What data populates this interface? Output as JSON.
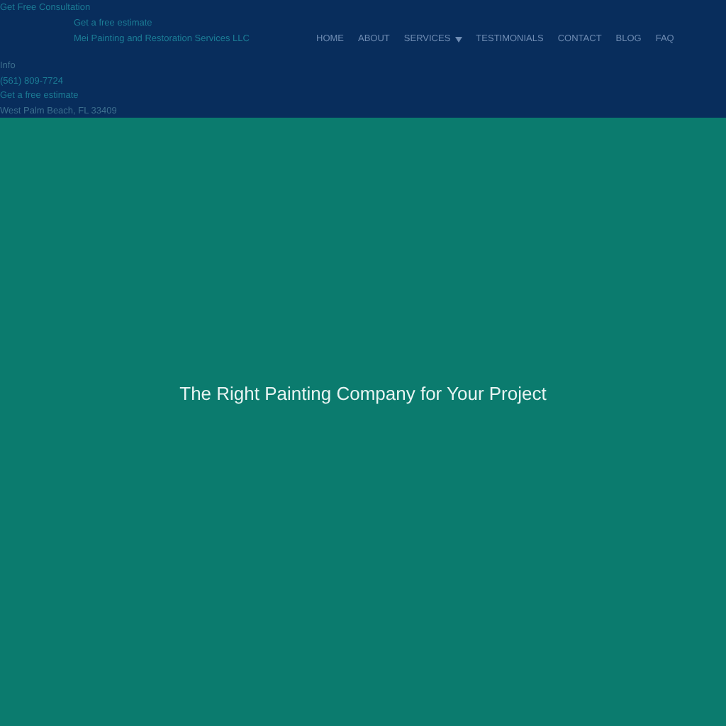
{
  "header": {
    "consultation": "Get Free Consultation",
    "estimate": "Get a free estimate",
    "company": "Mei Painting and Restoration Services LLC",
    "nav": [
      {
        "label": "HOME",
        "dropdown": false
      },
      {
        "label": "ABOUT",
        "dropdown": false
      },
      {
        "label": "SERVICES",
        "dropdown": true
      },
      {
        "label": "TESTIMONIALS",
        "dropdown": false
      },
      {
        "label": "CONTACT",
        "dropdown": false
      },
      {
        "label": "BLOG",
        "dropdown": false
      },
      {
        "label": "FAQ",
        "dropdown": false
      }
    ],
    "info": {
      "heading": "Info",
      "phone": "(561) 809-7724",
      "estimate": "Get a free estimate",
      "address": "West Palm Beach, FL 33409"
    }
  },
  "hero": {
    "title": "The Right Painting Company for Your Project"
  }
}
